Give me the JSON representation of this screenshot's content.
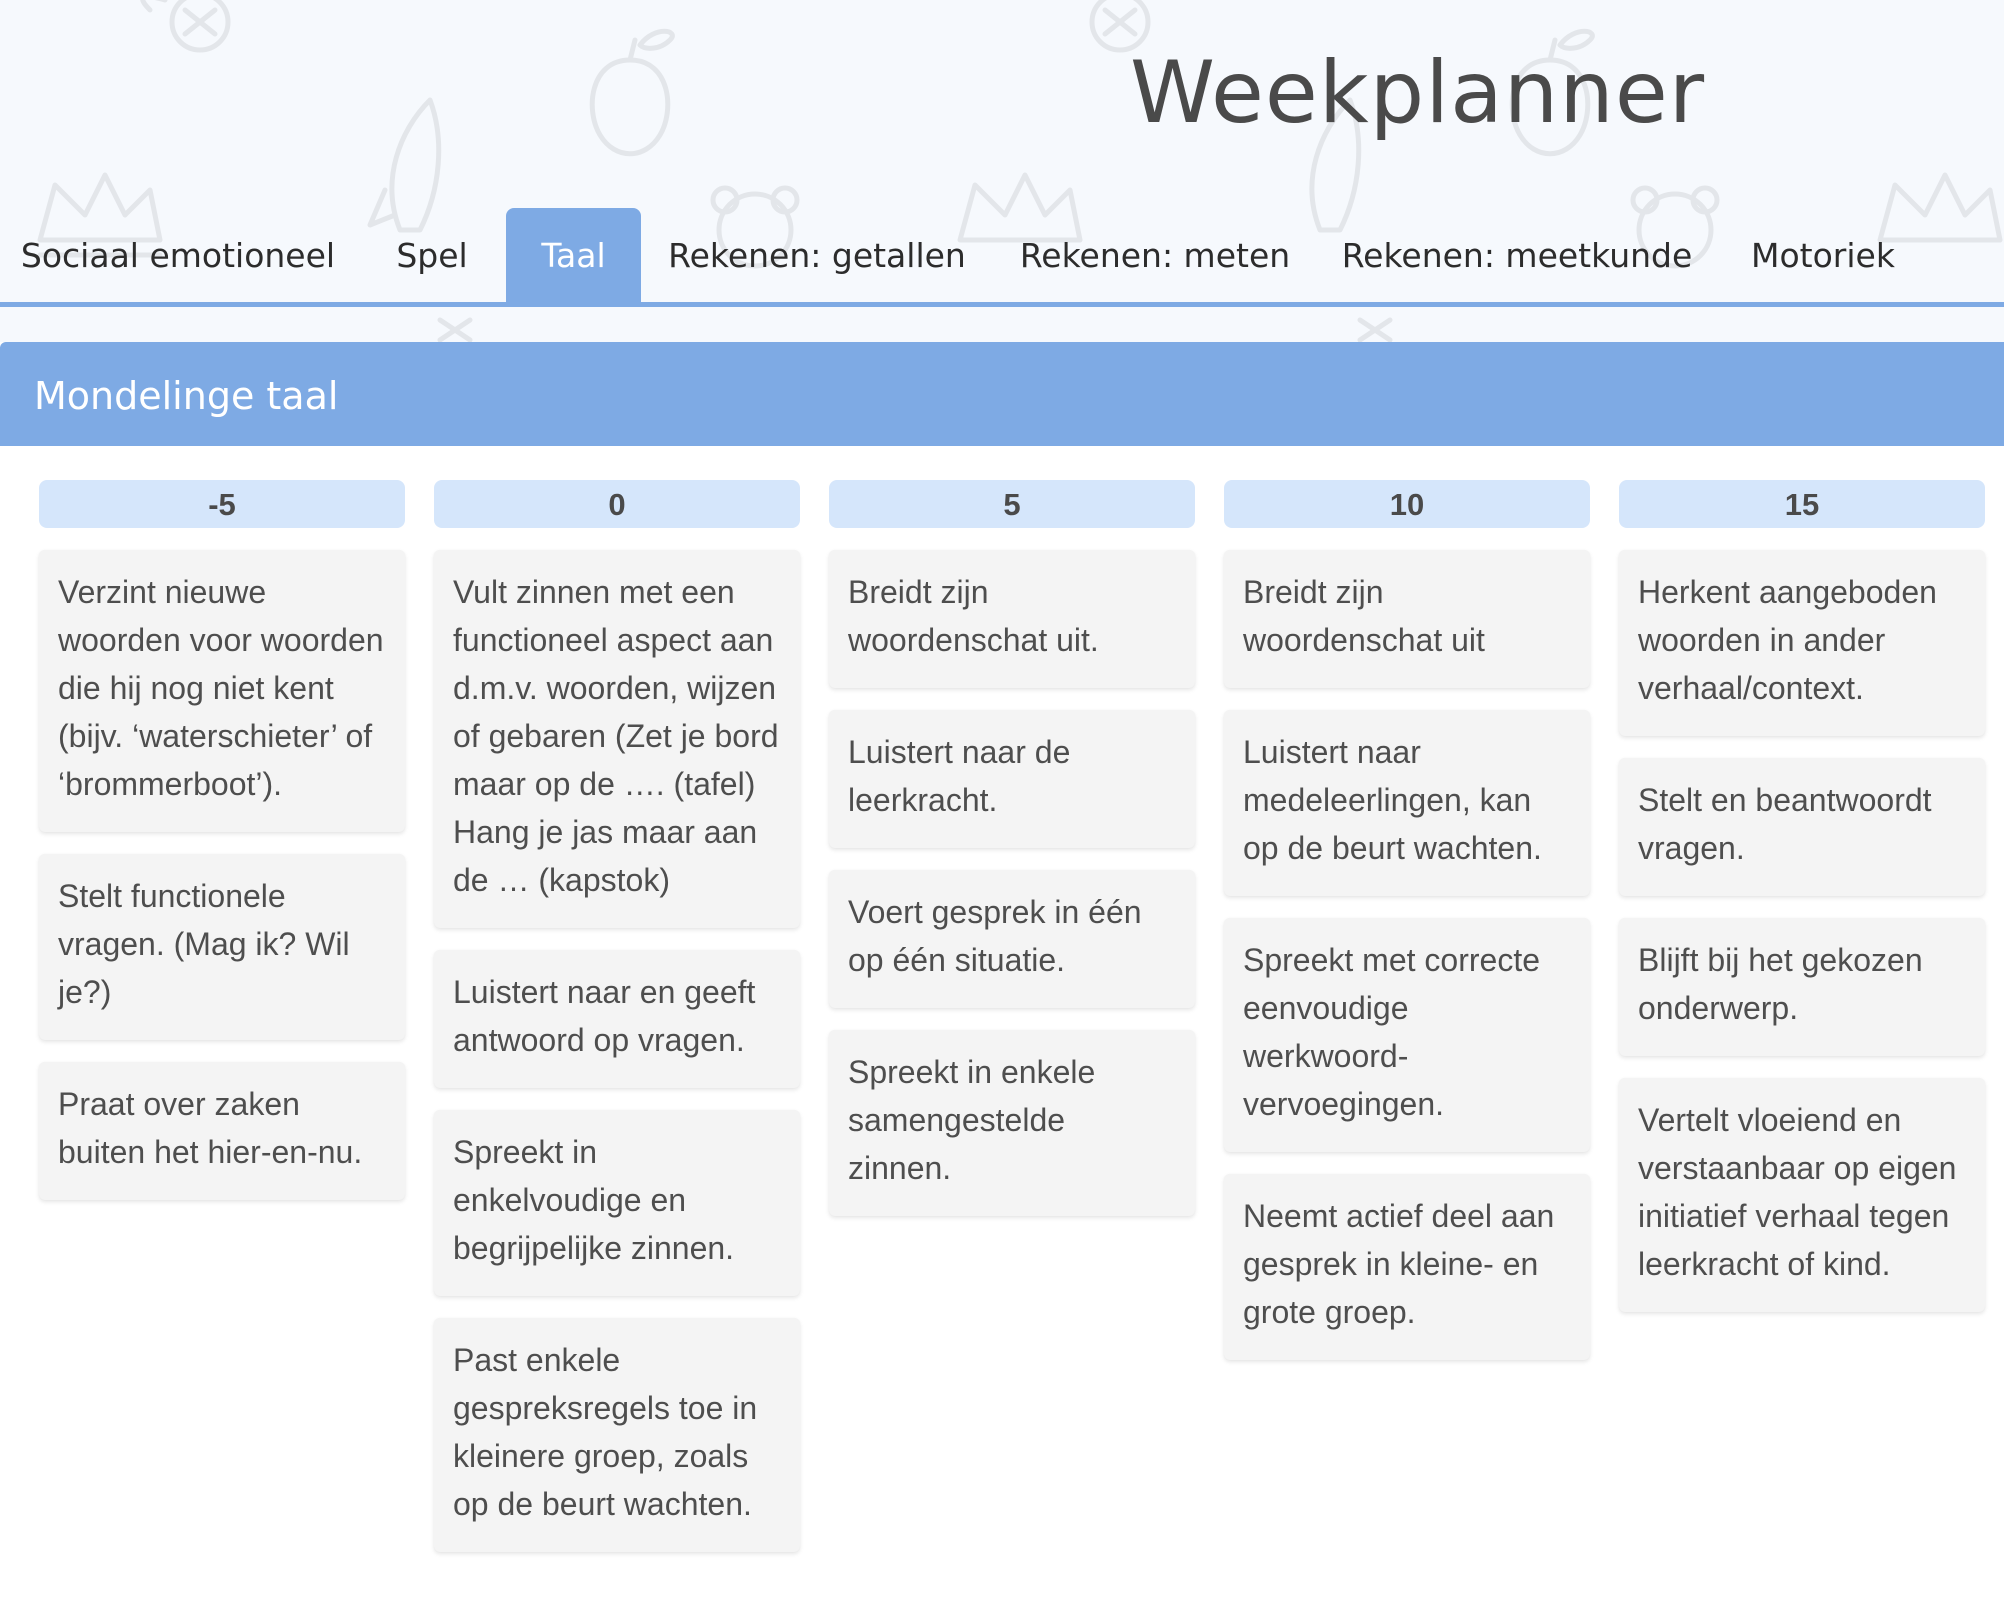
{
  "app": {
    "title": "Weekplanner"
  },
  "tabs": [
    {
      "label": "Sociaal emotioneel",
      "active": false
    },
    {
      "label": "Spel",
      "active": false
    },
    {
      "label": "Taal",
      "active": true
    },
    {
      "label": "Rekenen: getallen",
      "active": false
    },
    {
      "label": "Rekenen: meten",
      "active": false
    },
    {
      "label": "Rekenen: meetkunde",
      "active": false
    },
    {
      "label": "Motoriek",
      "active": false
    }
  ],
  "section": {
    "title": "Mondelinge taal"
  },
  "columns": [
    {
      "header": "-5",
      "cards": [
        "Verzint nieuwe woorden voor woorden die hij nog niet kent (bijv. ‘waterschieter’ of ‘brommerboot’).",
        "Stelt functionele vragen. (Mag ik? Wil je?)",
        "Praat over zaken buiten het hier-en-nu."
      ]
    },
    {
      "header": "0",
      "cards": [
        "Vult zinnen met een functioneel aspect aan d.m.v. woorden, wijzen of gebaren (Zet je bord maar op de …. (tafel) Hang je jas maar aan de … (kapstok)",
        "Luistert naar en geeft antwoord op vragen.",
        "Spreekt in enkelvoudige en begrijpelijke zinnen.",
        "Past enkele gespreksregels toe in kleinere groep, zoals op de beurt wachten."
      ]
    },
    {
      "header": "5",
      "cards": [
        "Breidt zijn woordenschat uit.",
        "Luistert naar de leerkracht.",
        "Voert gesprek in één op één situatie.",
        "Spreekt in enkele samengestelde zinnen."
      ]
    },
    {
      "header": "10",
      "cards": [
        "Breidt zijn woordenschat uit",
        "Luistert naar medeleerlingen, kan op de beurt wachten.",
        "Spreekt met correcte eenvoudige werkwoord-vervoegingen.",
        "Neemt actief deel aan gesprek in kleine- en grote groep."
      ]
    },
    {
      "header": "15",
      "cards": [
        "Herkent aangeboden woorden in ander verhaal/context.",
        "Stelt en beantwoordt vragen.",
        "Blijft bij het gekozen onderwerp.",
        "Vertelt vloeiend en verstaanbaar op eigen initiatief verhaal tegen leerkracht of kind."
      ]
    }
  ],
  "colors": {
    "accent": "#7eaae4",
    "column_header_bg": "#d5e6fb",
    "card_bg": "#f4f4f4",
    "header_bg": "#f6f9fd"
  }
}
